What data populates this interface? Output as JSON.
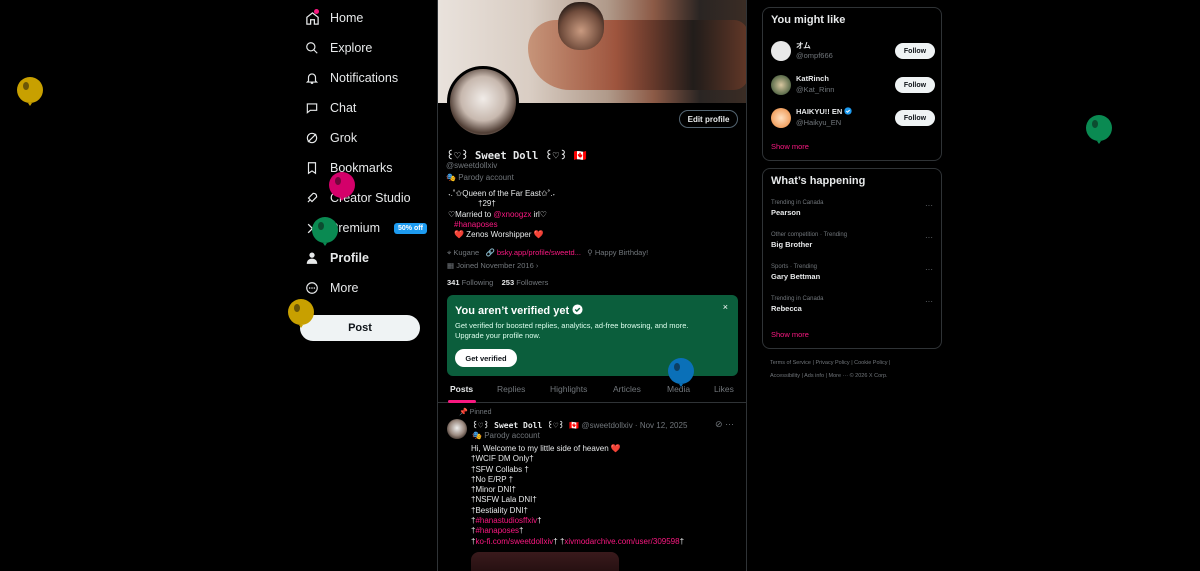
{
  "nav": {
    "items": [
      {
        "label": "Home",
        "icon": "home-icon"
      },
      {
        "label": "Explore",
        "icon": "search-icon"
      },
      {
        "label": "Notifications",
        "icon": "bell-icon"
      },
      {
        "label": "Chat",
        "icon": "chat-icon"
      },
      {
        "label": "Grok",
        "icon": "grok-icon"
      },
      {
        "label": "Bookmarks",
        "icon": "bookmark-icon"
      },
      {
        "label": "Creator Studio",
        "icon": "rocket-icon"
      },
      {
        "label": "Premium",
        "icon": "x-logo-icon"
      },
      {
        "label": "Profile",
        "icon": "person-icon"
      },
      {
        "label": "More",
        "icon": "more-circle-icon"
      }
    ],
    "premium_badge": "50% off",
    "post_label": "Post"
  },
  "profile": {
    "edit_label": "Edit profile",
    "name": "꒰♡꒱ Sweet Doll ꒰♡꒱ 🇨🇦",
    "handle": "@sweetdollxiv",
    "parody": "Parody account",
    "bio_lines": [
      "˖.˚✩Queen of the Far East✩˚.˖",
      "†29†",
      "♡Married to ",
      "@xnoogzx",
      " irl♡",
      "#hanaposes",
      "❤️ Zenos Worshipper ❤️"
    ],
    "location": "Kugane",
    "link": "bsky.app/profile/sweetd...",
    "birthday": "Happy Birthday!",
    "joined": "Joined November 2016",
    "following_count": "341",
    "following_label": "Following",
    "followers_count": "253",
    "followers_label": "Followers"
  },
  "verify": {
    "title": "You aren’t verified yet",
    "desc": "Get verified for boosted replies, analytics, ad-free browsing, and more. Upgrade your profile now.",
    "button": "Get verified",
    "close": "×"
  },
  "tabs": [
    "Posts",
    "Replies",
    "Highlights",
    "Articles",
    "Media",
    "Likes"
  ],
  "tweet": {
    "pinned": "Pinned",
    "name": "꒰♡꒱ Sweet Doll ꒰♡꒱ 🇨🇦",
    "handle_date": "@sweetdollxiv · Nov 12, 2025",
    "parody": "Parody account",
    "lines": [
      "Hi, Welcome to my little side of heaven ❤️",
      "†WCIF DM Only†",
      "†SFW Collabs †",
      "†No E/RP †",
      "†Minor DNI†",
      "†NSFW Lala DNI†",
      "†Bestiality DNI†"
    ],
    "link1": "#hanastudiosffxiv",
    "link2": "#hanaposes",
    "link3": "ko-fi.com/sweetdollxiv",
    "link4": "xivmodarchive.com/user/309598"
  },
  "suggestions": {
    "title": "You might like",
    "items": [
      {
        "name": "オム",
        "handle": "@ompf666",
        "color": "#e8e8e8"
      },
      {
        "name": "KatRinch",
        "handle": "@Kat_Rinn",
        "color": "#5a6b4a"
      },
      {
        "name": "HAIKYU!! EN",
        "handle": "@Haikyu_EN",
        "color": "#f0a060"
      }
    ],
    "follow_label": "Follow",
    "show_more": "Show more"
  },
  "trends": {
    "title": "What’s happening",
    "items": [
      {
        "context": "Trending in Canada",
        "name": "Pearson"
      },
      {
        "context": "Other competition · Trending",
        "name": "Big Brother"
      },
      {
        "context": "Sports · Trending",
        "name": "Gary Bettman"
      },
      {
        "context": "Trending in Canada",
        "name": "Rebecca"
      }
    ],
    "show_more": "Show more"
  },
  "footer": {
    "line1": "Terms of Service  |  Privacy Policy  |  Cookie Policy  |",
    "line2": "Accessibility  |  Ads info  |  More ···  © 2026 X Corp."
  },
  "colors": {
    "accent": "#f91880",
    "verify_bg": "#0b5e3c",
    "balloon_yellow": "#c8a000",
    "balloon_pink": "#d4006a",
    "balloon_green": "#0a8a52",
    "balloon_blue": "#0a70b8"
  }
}
